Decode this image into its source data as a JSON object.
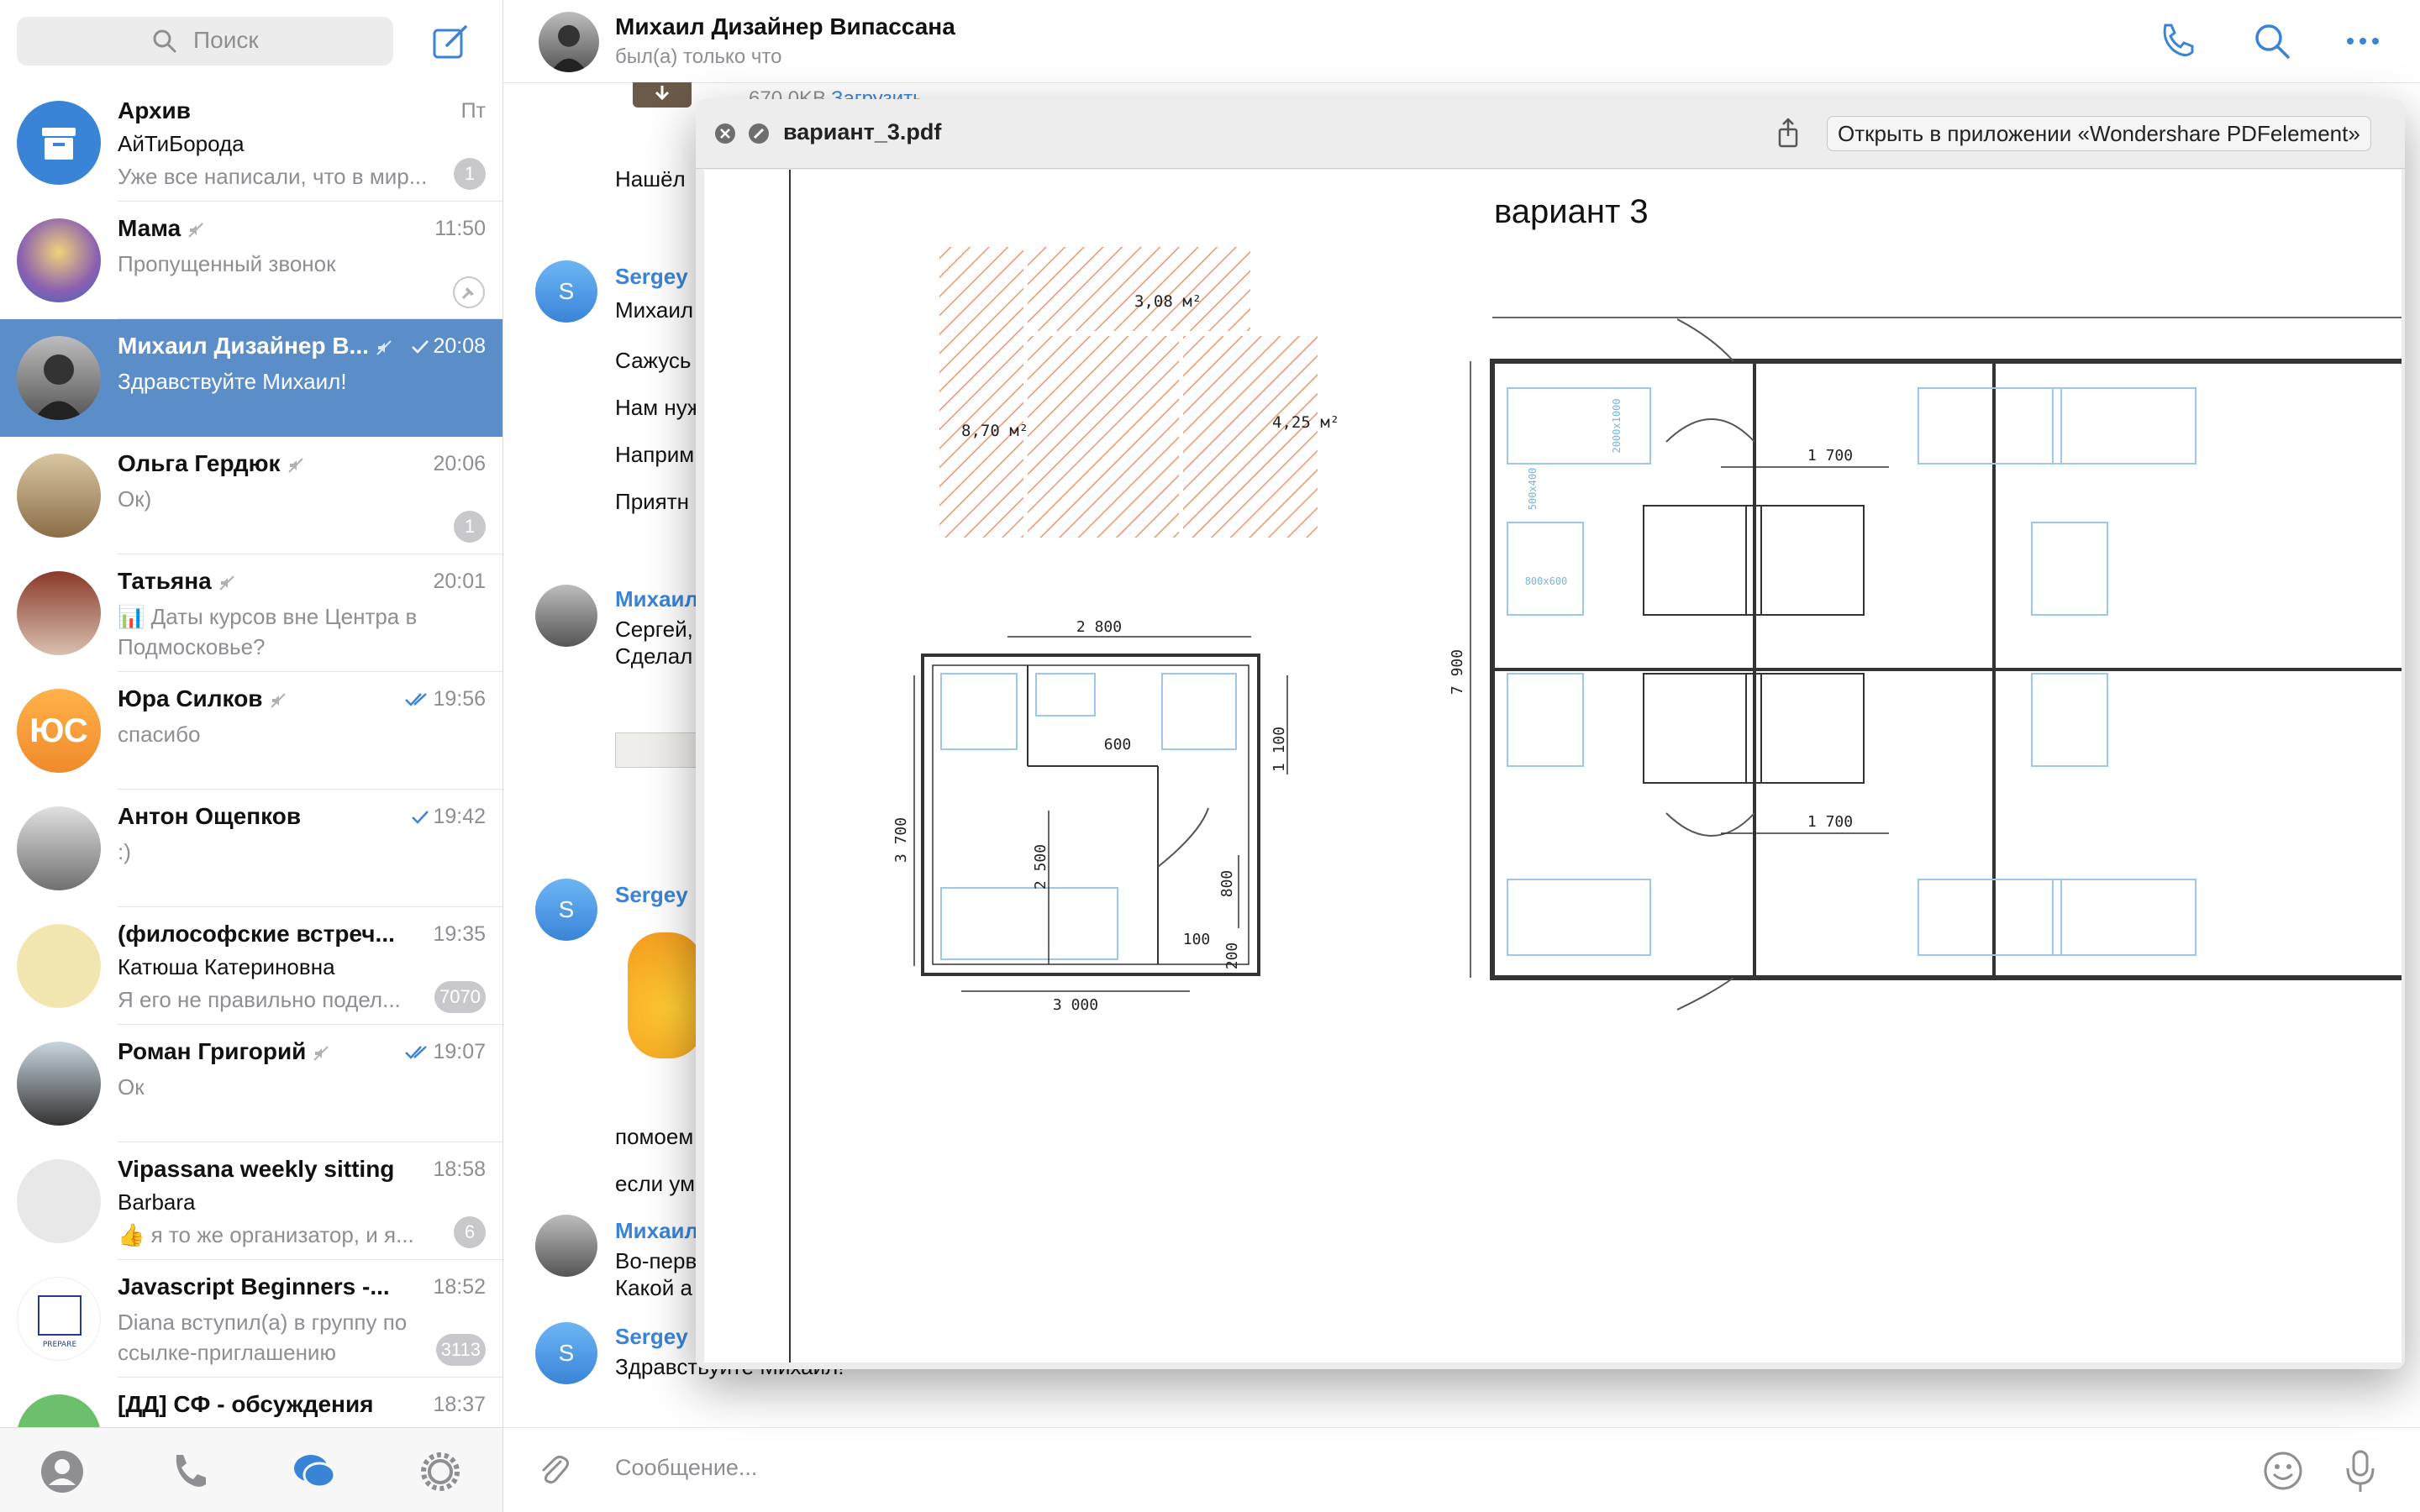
{
  "sidebar": {
    "search_placeholder": "Поиск",
    "chats": [
      {
        "name": "Архив",
        "time": "Пт",
        "line1": "АйТиБорода",
        "preview": "Уже все написали, что в мир...",
        "badge": "1"
      },
      {
        "name": "Мама",
        "time": "11:50",
        "preview": "Пропущенный звонок",
        "pinned": true
      },
      {
        "name": "Михаил Дизайнер В...",
        "time": "20:08",
        "preview": "Здравствуйте Михаил!",
        "selected": true
      },
      {
        "name": "Ольга Гердюк",
        "time": "20:06",
        "preview": "Ок)",
        "badge": "1"
      },
      {
        "name": "Татьяна",
        "time": "20:01",
        "preview": "📊 Даты курсов вне Центра в",
        "preview2": "Подмосковье?"
      },
      {
        "name": "Юра Силков",
        "time": "19:56",
        "preview": "спасибо",
        "avatar_text": "ЮС"
      },
      {
        "name": "Антон Ощепков",
        "time": "19:42",
        "preview": ":)"
      },
      {
        "name": "(философские встреч...",
        "time": "19:35",
        "line1": "Катюша Катериновна",
        "preview": "Я его не правильно подел...",
        "badge": "7070"
      },
      {
        "name": "Роман Григорий",
        "time": "19:07",
        "preview": "Ок"
      },
      {
        "name": "Vipassana weekly sitting",
        "time": "18:58",
        "line1": "Barbara",
        "preview": "👍 я то же организатор, и я...",
        "badge": "6"
      },
      {
        "name": "Javascript Beginners -...",
        "time": "18:52",
        "preview": "Diana вступил(а) в группу по",
        "preview2": "ссылке-приглашению",
        "badge": "3113"
      },
      {
        "name": "[ДД] СФ - обсуждения",
        "time": "18:37"
      }
    ]
  },
  "chat": {
    "title": "Михаил Дизайнер Випассана",
    "status": "был(а) только что",
    "file_size": "670.0KB",
    "download_label": "Загрузить",
    "messages": [
      {
        "text": "Нашёл"
      },
      {
        "sender": "Sergey",
        "text": "Михаил"
      },
      {
        "text": "Сажусь"
      },
      {
        "text": "Нам нуж"
      },
      {
        "text": "Наприм"
      },
      {
        "text": "Приятн"
      },
      {
        "sender": "Михаил",
        "text": "Сергей,",
        "text2": "Сделал"
      },
      {
        "sender": "Sergey"
      },
      {
        "text": "помоем"
      },
      {
        "text": "если ум"
      },
      {
        "sender": "Михаил",
        "text": "Во-перв",
        "text2": "Какой а"
      },
      {
        "sender": "Sergey",
        "text": "Здравствуйте Михаил!"
      }
    ],
    "input_placeholder": "Сообщение..."
  },
  "pdf": {
    "filename": "вариант_3.pdf",
    "open_in_app": "Открыть в приложении «Wondershare PDFelement»",
    "page_title": "вариант 3",
    "areas": [
      "3,08",
      "8,70",
      "4,25"
    ],
    "area_unit": "м²",
    "dims_left": [
      "2 800",
      "600",
      "1 100",
      "3 700",
      "2 500",
      "800",
      "100",
      "200",
      "3 000"
    ],
    "dims_right": [
      "1 700",
      "1 700",
      "7 900"
    ],
    "furniture": [
      "2000x1000",
      "500x400",
      "800x600"
    ]
  }
}
